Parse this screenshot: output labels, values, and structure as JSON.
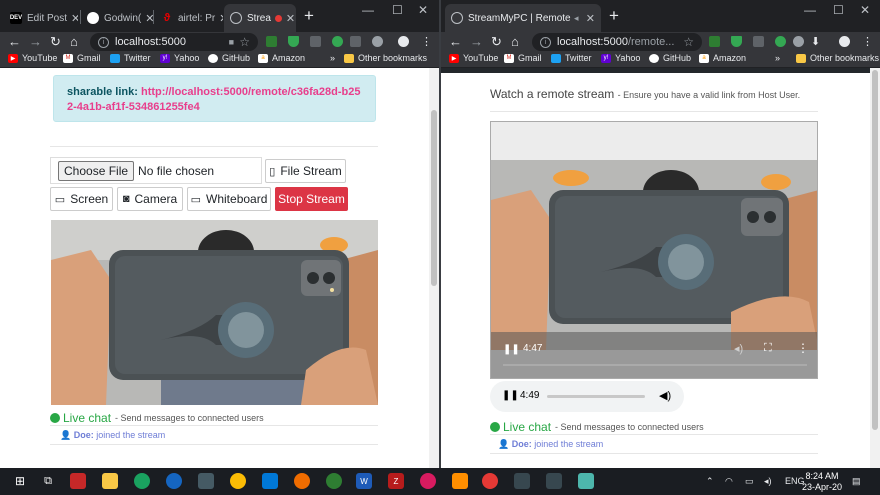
{
  "left_window": {
    "tabs": [
      {
        "label": "Edit Post",
        "favicon": "DEV"
      },
      {
        "label": "Godwin(",
        "favicon": "github"
      },
      {
        "label": "airtel: Pr",
        "favicon": "airtel"
      },
      {
        "label": "Strea",
        "favicon": "globe",
        "active": true,
        "recording": true
      }
    ],
    "omnibox_host": "localhost:5000",
    "omnibox_path": ""
  },
  "right_window": {
    "tabs": [
      {
        "label": "StreamMyPC | Remote",
        "favicon": "globe",
        "active": true
      }
    ],
    "omnibox_host": "localhost:5000",
    "omnibox_path": "/remote..."
  },
  "bookmarks_left": [
    "YouTube",
    "Gmail",
    "Twitter",
    "Yahoo",
    "GitHub",
    "Amazon"
  ],
  "bookmarks_right": [
    "YouTube",
    "Gmail",
    "Twitter",
    "Yahoo",
    "GitHub",
    "Amazon"
  ],
  "bookmarks_more": "»",
  "other_bookmarks": "Other bookmarks",
  "host_page": {
    "sharable_label": "sharable link:",
    "sharable_url": "http://localhost:5000/remote/c36fa28d-b252-4a1b-af1f-534861255fe4",
    "choose_file": "Choose File",
    "no_file": "No file chosen",
    "file_stream": "File Stream",
    "screen": "Screen",
    "camera": "Camera",
    "whiteboard": "Whiteboard",
    "stop_stream": "Stop Stream",
    "live_chat": "Live chat",
    "live_chat_sub": "Send messages to connected users",
    "chat_user": "Doe:",
    "chat_text": "joined the stream"
  },
  "remote_page": {
    "title": "Watch a remote stream",
    "title_sub": "Ensure you have a valid link from Host User.",
    "video_time": "4:47",
    "audio_time": "4:49",
    "live_chat": "Live chat",
    "live_chat_sub": "Send messages to connected users",
    "chat_user": "Doe:",
    "chat_text": "joined the stream"
  },
  "taskbar": {
    "lang": "ENG",
    "time": "8:24 AM",
    "date": "23-Apr-20"
  },
  "colors": {
    "chrome_dark": "#202124",
    "chrome_toolbar": "#35363a",
    "alert_bg": "#d1ecf1",
    "link_pink": "#e83e8c",
    "danger": "#dc3545",
    "chat_green": "#28a745"
  }
}
